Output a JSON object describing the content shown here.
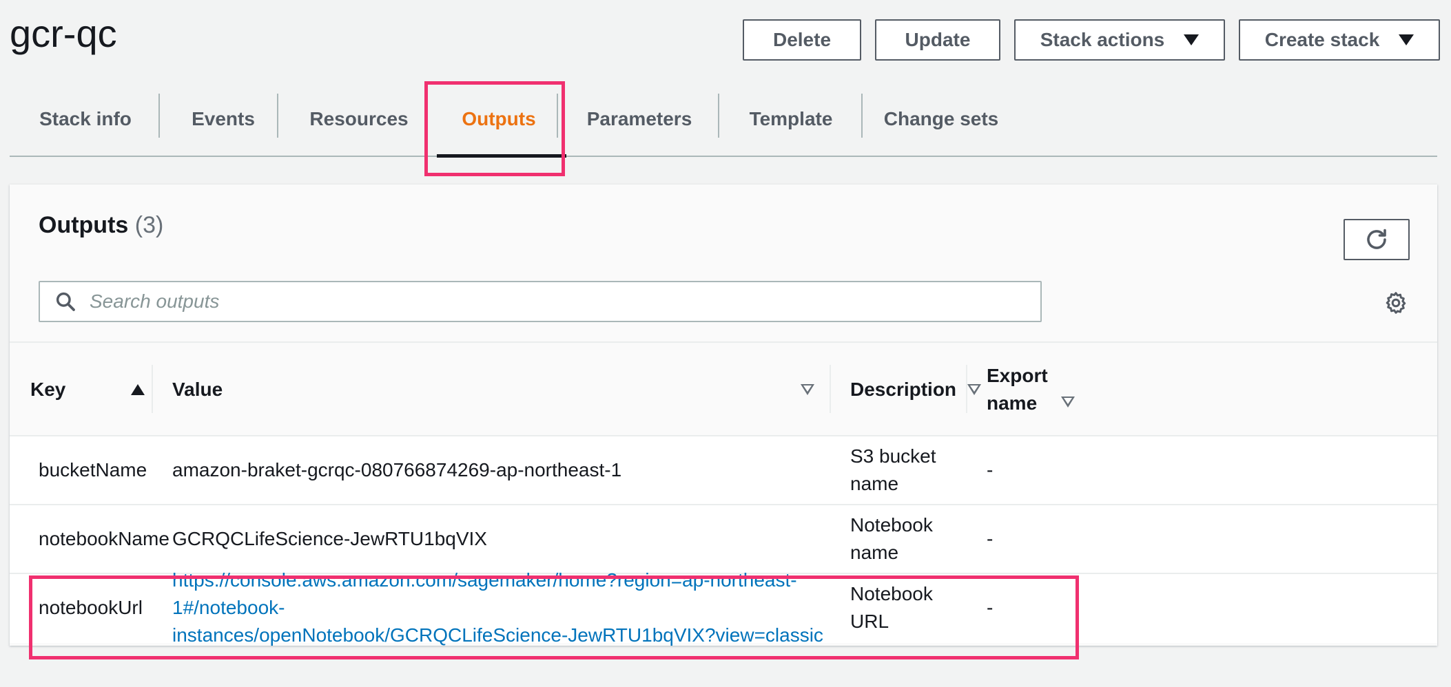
{
  "stack": {
    "title": "gcr-qc"
  },
  "actions": {
    "delete_label": "Delete",
    "update_label": "Update",
    "stack_actions_label": "Stack actions",
    "create_stack_label": "Create stack"
  },
  "tabs": [
    {
      "label": "Stack info",
      "active": false
    },
    {
      "label": "Events",
      "active": false
    },
    {
      "label": "Resources",
      "active": false
    },
    {
      "label": "Outputs",
      "active": true
    },
    {
      "label": "Parameters",
      "active": false
    },
    {
      "label": "Template",
      "active": false
    },
    {
      "label": "Change sets",
      "active": false
    }
  ],
  "outputs": {
    "title": "Outputs",
    "count": "(3)",
    "search": {
      "placeholder": "Search outputs",
      "value": ""
    },
    "columns": {
      "key": "Key",
      "value": "Value",
      "description": "Description",
      "export_name_line1": "Export",
      "export_name_line2": "name"
    },
    "rows": [
      {
        "key": "bucketName",
        "value": "amazon-braket-gcrqc-080766874269-ap-northeast-1",
        "description": "S3 bucket name",
        "export_name": "-"
      },
      {
        "key": "notebookName",
        "value": "GCRQCLifeScience-JewRTU1bqVIX",
        "description": "Notebook name",
        "export_name": "-"
      },
      {
        "key": "notebookUrl",
        "value_line1": "https://console.aws.amazon.com/sagemaker/home?region=ap-northeast-1#/notebook-",
        "value_line2": "instances/openNotebook/GCRQCLifeScience-JewRTU1bqVIX?view=classic",
        "description": "Notebook URL",
        "export_name": "-"
      }
    ]
  },
  "icons": {
    "refresh": "refresh-icon",
    "search": "search-icon",
    "settings": "gear-icon",
    "dropdown": "caret-down-icon",
    "sort_asc": "sort-ascending-icon",
    "sort": "sort-icon"
  },
  "colors": {
    "accent_tab": "#ec7211",
    "link": "#0073bb",
    "highlight": "#f0306f",
    "background": "#f2f3f3"
  }
}
